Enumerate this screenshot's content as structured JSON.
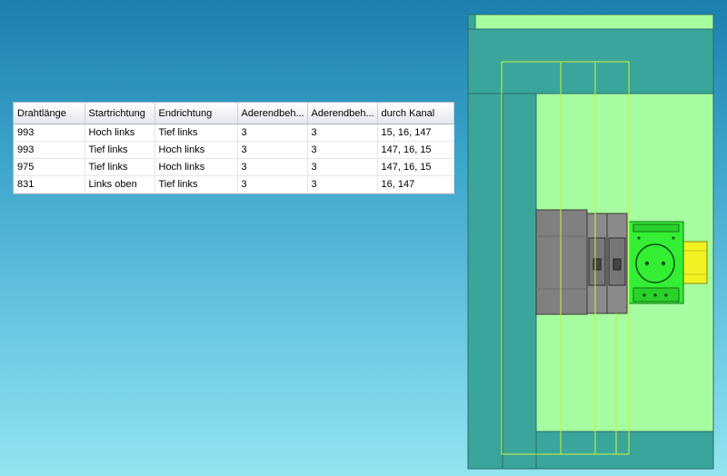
{
  "wire_table": {
    "columns": [
      "Drahtlänge",
      "Startrichtung",
      "Endrichtung",
      "Aderendbeh...",
      "Aderendbeh...",
      "durch Kanal"
    ],
    "rows": [
      [
        "993",
        "Hoch links",
        "Tief links",
        "3",
        "3",
        "15, 16, 147"
      ],
      [
        "993",
        "Tief links",
        "Hoch links",
        "3",
        "3",
        "147, 16, 15"
      ],
      [
        "975",
        "Tief links",
        "Hoch links",
        "3",
        "3",
        "147, 16, 15"
      ],
      [
        "831",
        "Links oben",
        "Tief links",
        "3",
        "3",
        "16, 147"
      ]
    ]
  },
  "colors": {
    "panel_green": "#a6fca0",
    "cabinet_teal": "#3aa59a",
    "device_gray": "#808080",
    "socket_green": "#33ee33",
    "rail_yellow": "#f2f222",
    "wire_outline": "#c8f23c"
  },
  "icons": {
    "socket": "schuko-socket-icon"
  }
}
